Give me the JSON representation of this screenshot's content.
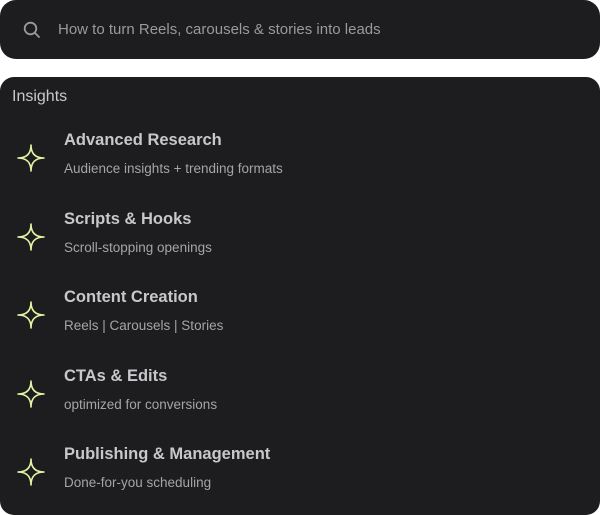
{
  "search": {
    "placeholder": "How to turn Reels, carousels & stories into leads",
    "icon": "search-icon"
  },
  "insights": {
    "title": "Insights",
    "accent_color": "#e2f5a4",
    "items": [
      {
        "title": "Advanced Research",
        "subtitle": "Audience insights + trending formats",
        "icon": "sparkle-icon"
      },
      {
        "title": "Scripts & Hooks",
        "subtitle": "Scroll-stopping openings",
        "icon": "sparkle-icon"
      },
      {
        "title": "Content Creation",
        "subtitle": "Reels | Carousels | Stories",
        "icon": "sparkle-icon"
      },
      {
        "title": "CTAs & Edits",
        "subtitle": "optimized for conversions",
        "icon": "sparkle-icon"
      },
      {
        "title": "Publishing & Management",
        "subtitle": "Done-for-you scheduling",
        "icon": "sparkle-icon"
      }
    ]
  }
}
